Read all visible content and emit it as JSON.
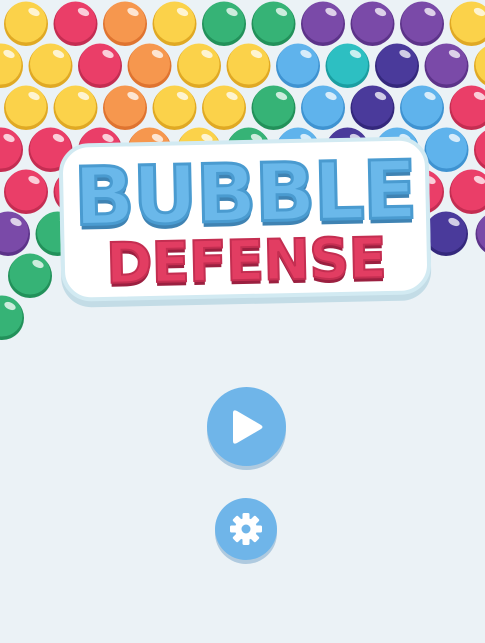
{
  "game": {
    "title_line_1": "BUBBLE",
    "title_line_2": "DEFENSE"
  },
  "controls": {
    "play_icon": "play-icon",
    "settings_icon": "gear-icon"
  },
  "colors": {
    "background": "#ebf2f6",
    "title_blue": "#6ab8ea",
    "title_red": "#e23d62",
    "button_blue": "#6fb5e9"
  },
  "bubble_rows": [
    [
      "yellow",
      "red",
      "orange",
      "yellow",
      "green",
      "green",
      "purple",
      "purple",
      "purple",
      "yellow"
    ],
    [
      "yellow",
      "yellow",
      "red",
      "orange",
      "yellow",
      "yellow",
      "blue",
      "cyan",
      "navy",
      "purple",
      "yellow"
    ],
    [
      "yellow",
      "yellow",
      "orange",
      "yellow",
      "yellow",
      "green",
      "blue",
      "navy",
      "blue",
      "red"
    ],
    [
      "red",
      "red",
      "red",
      "orange",
      "yellow",
      "green",
      "blue",
      "navy",
      "blue",
      "blue",
      "red"
    ],
    [
      "red",
      "red",
      "yellow",
      "yellow",
      "yellow",
      "green",
      "navy",
      "navy",
      "red",
      "red"
    ],
    [
      "purple",
      "green",
      "",
      "",
      "",
      "",
      "",
      "",
      "navy",
      "purple",
      "purple"
    ],
    [
      "green"
    ],
    [
      "green"
    ]
  ]
}
